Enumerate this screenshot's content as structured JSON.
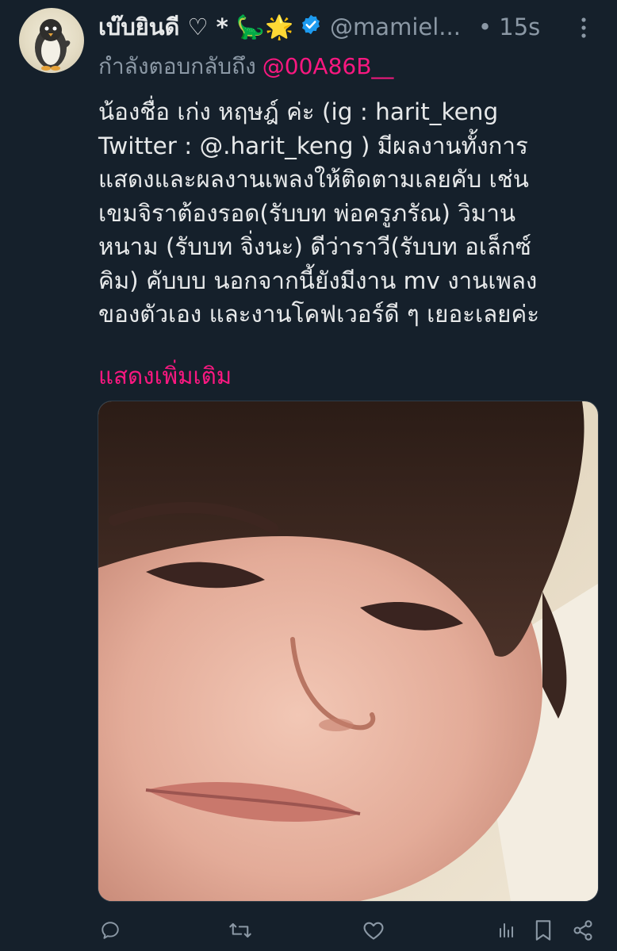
{
  "tweet": {
    "display_name": "เบ๊บยินดี ♡ * 🦕🌟",
    "handle": "@mamiel...",
    "dot_time": "• 15s",
    "reply_prefix": "กำลังตอบกลับถึง",
    "reply_mention": "@00A86B__",
    "body_lines": [
      "น้องชื่อ เก่ง หฤษฎ์ ค่ะ (ig : harit_keng",
      "Twitter : @.harit_keng ) มีผลงานทั้งการ",
      "แสดงและผลงานเพลงให้ติดตามเลยคับ เช่น",
      "เขมจิราต้องรอด(รับบท พ่อครูภรัณ) วิมาน",
      "หนาม (รับบท จิ่งนะ) ดีว่าราวี(รับบท อเล็กซ์",
      "คิม) คับบบ นอกจากนี้ยังมีงาน mv งานเพลง",
      "ของตัวเอง และงานโคฟเวอร์ดี ๆ เยอะเลยค่ะ"
    ],
    "show_more": "แสดงเพิ่มเติม"
  },
  "colors": {
    "background": "#15202b",
    "text": "#e7e9ea",
    "muted": "#8b98a5",
    "accent": "#f91880",
    "verified": "#1d9bf0"
  },
  "icons": {
    "verified": "verified-badge-icon",
    "more": "more-vertical-icon",
    "reply": "reply-icon",
    "retweet": "retweet-icon",
    "like": "heart-icon",
    "views": "views-chart-icon",
    "bookmark": "bookmark-icon",
    "share": "share-icon"
  }
}
